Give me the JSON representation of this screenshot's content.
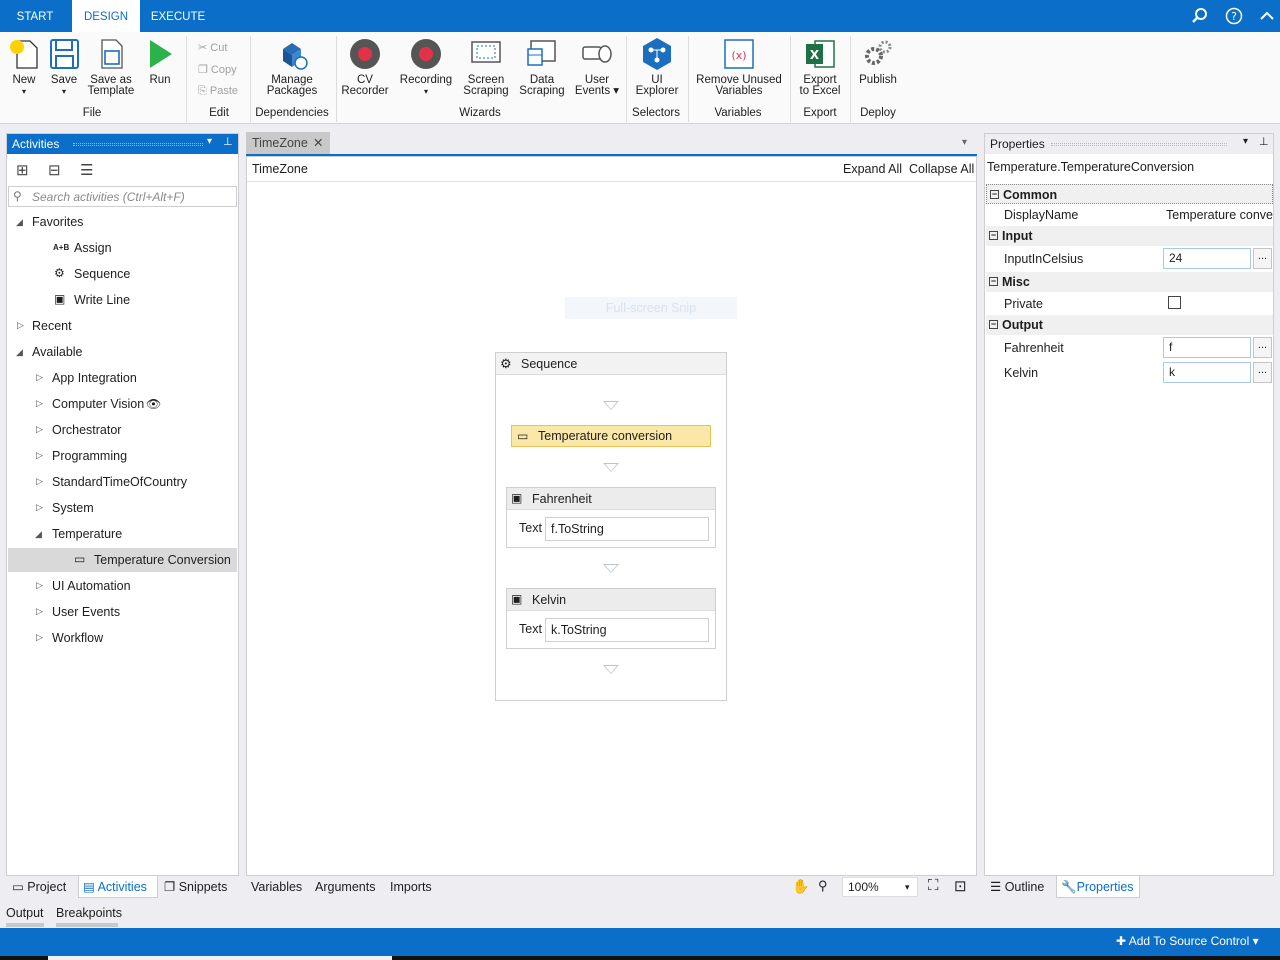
{
  "tabs": {
    "start": "START",
    "design": "DESIGN",
    "execute": "EXECUTE"
  },
  "ribbon": {
    "new": "New",
    "save": "Save",
    "save_template_1": "Save as",
    "save_template_2": "Template",
    "run": "Run",
    "cut": "Cut",
    "copy": "Copy",
    "paste": "Paste",
    "manage_1": "Manage",
    "manage_2": "Packages",
    "cv_1": "CV",
    "cv_2": "Recorder",
    "recording": "Recording",
    "screen_1": "Screen",
    "screen_2": "Scraping",
    "data_1": "Data",
    "data_2": "Scraping",
    "user_1": "User",
    "user_2": "Events",
    "ui_1": "UI",
    "ui_2": "Explorer",
    "remove_1": "Remove Unused",
    "remove_2": "Variables",
    "export_1": "Export",
    "export_2": "to Excel",
    "publish": "Publish",
    "groups": {
      "file": "File",
      "edit": "Edit",
      "dependencies": "Dependencies",
      "wizards": "Wizards",
      "selectors": "Selectors",
      "variables": "Variables",
      "export": "Export",
      "deploy": "Deploy"
    }
  },
  "activities": {
    "title": "Activities",
    "search_placeholder": "Search activities (Ctrl+Alt+F)",
    "favorites": "Favorites",
    "assign": "Assign",
    "sequence": "Sequence",
    "write_line": "Write Line",
    "recent": "Recent",
    "available": "Available",
    "app_integration": "App Integration",
    "computer_vision": "Computer Vision",
    "orchestrator": "Orchestrator",
    "programming": "Programming",
    "standard_time": "StandardTimeOfCountry",
    "system": "System",
    "temperature": "Temperature",
    "temperature_conversion": "Temperature Conversion",
    "ui_automation": "UI Automation",
    "user_events": "User Events",
    "workflow": "Workflow"
  },
  "left_tabs": {
    "project": "Project",
    "activities": "Activities",
    "snippets": "Snippets"
  },
  "output_tabs": {
    "output": "Output",
    "breakpoints": "Breakpoints"
  },
  "designer": {
    "doc_tab": "TimeZone",
    "breadcrumb": "TimeZone",
    "expand_all": "Expand All",
    "collapse_all": "Collapse All",
    "ghost": "Full-screen Snip",
    "sequence_title": "Sequence",
    "temp_activity": "Temperature conversion",
    "fahrenheit_title": "Fahrenheit",
    "fahrenheit_text_label": "Text",
    "fahrenheit_text_value": "f.ToString",
    "kelvin_title": "Kelvin",
    "kelvin_text_label": "Text",
    "kelvin_text_value": "k.ToString",
    "variables": "Variables",
    "arguments": "Arguments",
    "imports": "Imports",
    "zoom": "100%"
  },
  "properties": {
    "title": "Properties",
    "object": "Temperature.TemperatureConversion",
    "common": "Common",
    "display_name_label": "DisplayName",
    "display_name_value": "Temperature conver",
    "input": "Input",
    "input_celsius_label": "InputInCelsius",
    "input_celsius_value": "24",
    "misc": "Misc",
    "private_label": "Private",
    "output": "Output",
    "fahrenheit_label": "Fahrenheit",
    "fahrenheit_value": "f",
    "kelvin_label": "Kelvin",
    "kelvin_value": "k",
    "ellipsis": "..."
  },
  "right_tabs": {
    "outline": "Outline",
    "properties": "Properties"
  },
  "status": {
    "source_control": "Add To Source Control"
  },
  "colors": {
    "accent": "#0b6fc9",
    "selected_activity": "#fbe7a7",
    "run_green": "#2bb34a",
    "record_red": "#e0334a"
  }
}
